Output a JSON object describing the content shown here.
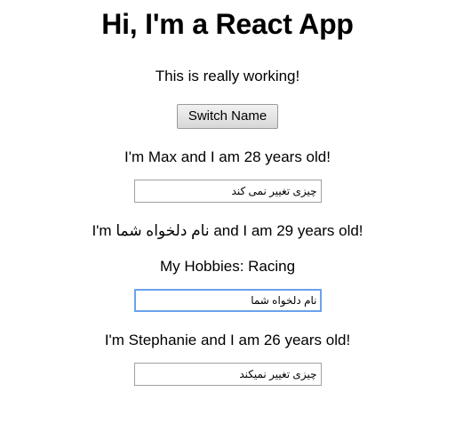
{
  "app": {
    "title": "Hi, I'm a React App",
    "subtitle": "This is really working!"
  },
  "toolbar": {
    "switch_name_label": "Switch Name"
  },
  "persons": [
    {
      "id": "person-max",
      "line_prefix": "I'm ",
      "name": "Max",
      "line_suffix": " and I am 28 years old!",
      "full_line": "I'm Max and I am 28 years old!",
      "input_value": "چیزی تغییر نمی کند",
      "input_focused": false
    },
    {
      "id": "person-custom",
      "line_prefix": "I'm ",
      "name": "نام دلخواه شما",
      "line_suffix": " and I am 29 years old!",
      "hobbies_line": "My Hobbies: Racing",
      "input_value": "نام دلخواه شما",
      "input_focused": true
    },
    {
      "id": "person-stephanie",
      "line_prefix": "I'm ",
      "name": "Stephanie",
      "line_suffix": " and I am 26 years old!",
      "full_line": "I'm Stephanie and I am 26 years old!",
      "input_value": "چیزی تغییر نمیکند",
      "input_focused": false
    }
  ],
  "colors": {
    "page_background": "#ffffff",
    "text": "#000000",
    "input_border": "#a0a0a0",
    "input_border_focused": "#6aa2ec",
    "button_border": "#9a9a9a",
    "button_face": "#e2e2e2"
  }
}
